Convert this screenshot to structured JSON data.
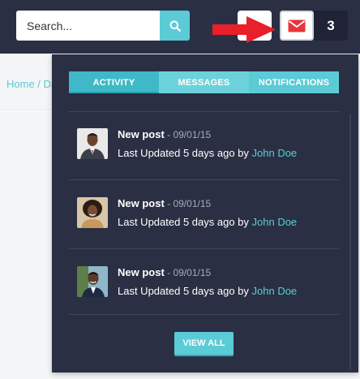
{
  "header": {
    "search": {
      "placeholder": "Search..."
    },
    "notification_count": "3",
    "icons": {
      "search": "search-icon",
      "mail": "envelope-icon",
      "arrow": "red-arrow-right"
    },
    "colors": {
      "topbar": "#2a2f43",
      "accent": "#5bcbd6",
      "mail_icon": "#e8343c",
      "arrow": "#e8202a"
    }
  },
  "breadcrumb": {
    "text": "Home / Da"
  },
  "dropdown": {
    "tabs": [
      {
        "label": "ACTIVITY"
      },
      {
        "label": "MESSAGES"
      },
      {
        "label": "NOTIFICATIONS"
      }
    ],
    "active_tab": "ACTIVITY",
    "items": [
      {
        "title": "New post",
        "date": " - 09/01/15",
        "description": "Last Updated 5 days ago by ",
        "author": "John Doe",
        "avatar": "man-in-suit-avatar"
      },
      {
        "title": "New post",
        "date": " - 09/01/15",
        "description": "Last Updated 5 days ago by ",
        "author": "John Doe",
        "avatar": "woman-curly-hair-avatar"
      },
      {
        "title": "New post",
        "date": " - 09/01/15",
        "description": "Last Updated 5 days ago by ",
        "author": "John Doe",
        "avatar": "man-outdoors-avatar"
      }
    ],
    "view_all_label": "VIEW ALL"
  }
}
